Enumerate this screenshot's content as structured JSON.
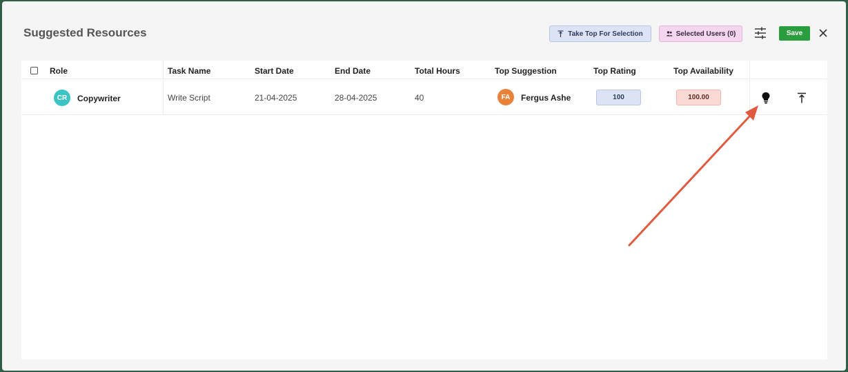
{
  "modal": {
    "title": "Suggested Resources",
    "take_top_label": "Take Top For Selection",
    "selected_users_label": "Selected Users (0)",
    "save_label": "Save"
  },
  "table": {
    "columns": [
      "Role",
      "Task Name",
      "Start Date",
      "End Date",
      "Total Hours",
      "Top Suggestion",
      "Top Rating",
      "Top Availability"
    ],
    "rows": [
      {
        "role_initials": "CR",
        "role": "Copywriter",
        "task_name": "Write Script",
        "start_date": "21-04-2025",
        "end_date": "28-04-2025",
        "total_hours": "40",
        "suggestion_initials": "FA",
        "top_suggestion": "Fergus Ashe",
        "top_rating": "100",
        "top_availability": "100.00"
      }
    ]
  },
  "colors": {
    "save": "#2a9d3e",
    "role_avatar": "#3cc3c3",
    "suggestion_avatar": "#e8823a",
    "annotation_arrow": "#e05a3f"
  },
  "icons": [
    "take-top-icon",
    "users-icon",
    "filter-settings-icon",
    "close-icon",
    "lightbulb-icon",
    "move-to-top-icon"
  ]
}
